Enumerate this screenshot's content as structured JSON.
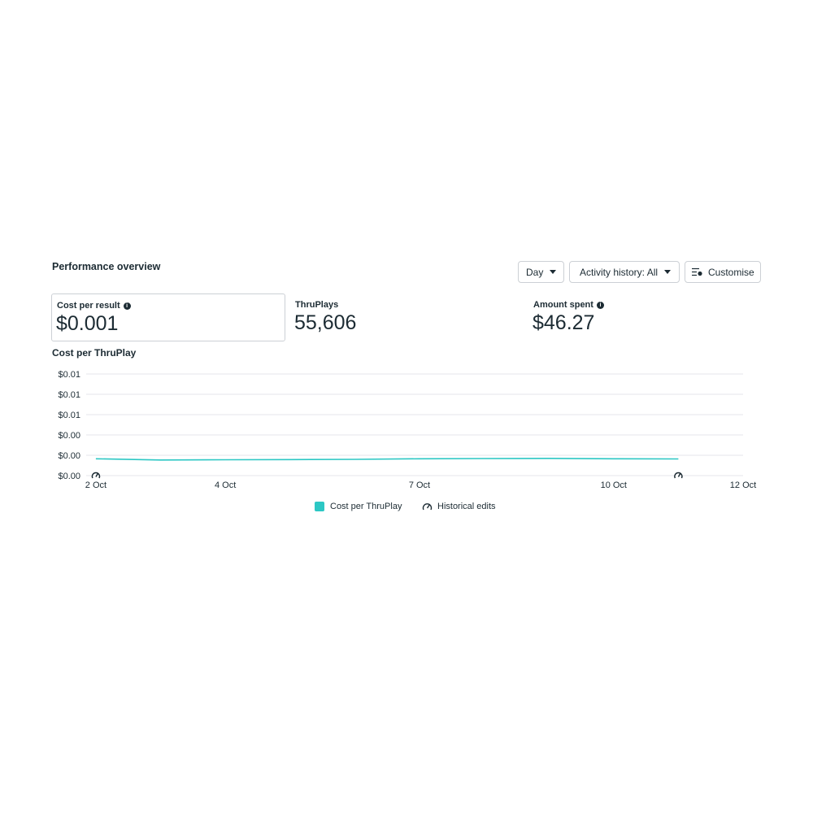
{
  "panel": {
    "title": "Performance overview"
  },
  "controls": {
    "day": "Day",
    "activity": "Activity history: All",
    "customise": "Customise"
  },
  "metrics": [
    {
      "label": "Cost per result",
      "value": "$0.001",
      "info": true,
      "selected": true
    },
    {
      "label": "ThruPlays",
      "value": "55,606",
      "info": false,
      "selected": false
    },
    {
      "label": "Amount spent",
      "value": "$46.27",
      "info": true,
      "selected": false
    }
  ],
  "chart_data": {
    "type": "line",
    "title": "Cost per ThruPlay",
    "y_tick_labels": [
      "$0.01",
      "$0.01",
      "$0.01",
      "$0.00",
      "$0.00",
      "$0.00"
    ],
    "x_tick_labels": [
      "2 Oct",
      "4 Oct",
      "7 Oct",
      "10 Oct",
      "12 Oct"
    ],
    "x_tick_days": [
      2,
      4,
      7,
      10,
      12
    ],
    "ylim": [
      0,
      0.005
    ],
    "grid": true,
    "series": [
      {
        "name": "Cost per ThruPlay",
        "color": "#2cc7c4",
        "x": [
          2,
          3,
          4,
          5,
          6,
          7,
          8,
          9,
          10,
          11
        ],
        "values": [
          0.00083,
          0.00077,
          0.00078,
          0.00079,
          0.0008,
          0.00083,
          0.00084,
          0.00085,
          0.00083,
          0.00082
        ]
      }
    ],
    "historical_edits_days": [
      2,
      11
    ],
    "legend": [
      "Cost per ThruPlay",
      "Historical edits"
    ],
    "legend_position": "bottom"
  },
  "colors": {
    "accent": "#2cc7c4",
    "text": "#1c2b33",
    "grid": "#e4e6eb"
  }
}
